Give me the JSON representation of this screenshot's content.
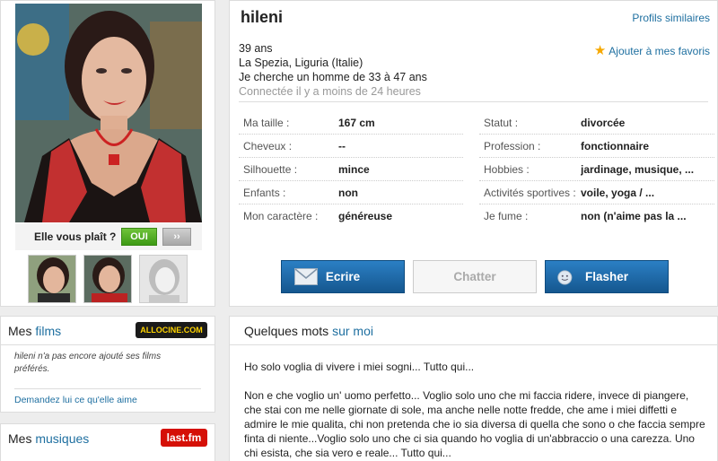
{
  "profile": {
    "username": "hileni",
    "similar_link": "Profils similaires",
    "favorite_label": "Ajouter à mes favoris",
    "age": "39 ans",
    "location": "La Spezia, Liguria (Italie)",
    "seeking": "Je cherche un homme de 33 à 47 ans",
    "last_online": "Connectée il y a moins de 24 heures"
  },
  "like_prompt": {
    "question": "Elle vous plaît ?",
    "yes_label": "OUI",
    "next_label": "››"
  },
  "attributes_left": [
    {
      "key": "Ma taille :",
      "value": "167 cm"
    },
    {
      "key": "Cheveux :",
      "value": "--"
    },
    {
      "key": "Silhouette :",
      "value": "mince"
    },
    {
      "key": "Enfants :",
      "value": "non"
    },
    {
      "key": "Mon caractère :",
      "value": "généreuse"
    }
  ],
  "attributes_right": [
    {
      "key": "Statut :",
      "value": "divorcée"
    },
    {
      "key": "Profession :",
      "value": "fonctionnaire"
    },
    {
      "key": "Hobbies :",
      "value": "jardinage, musique, ..."
    },
    {
      "key": "Activités sportives :",
      "value": "voile, yoga / ..."
    },
    {
      "key": "Je fume :",
      "value": "non (n'aime pas la ..."
    }
  ],
  "actions": {
    "write": "Ecrire",
    "chat": "Chatter",
    "flash": "Flasher"
  },
  "films": {
    "title_prefix": "Mes",
    "title_highlight": "films",
    "logo": "ALLOCINE.COM",
    "text": "hileni n'a pas encore ajouté ses films préférés.",
    "link": "Demandez lui ce qu'elle aime"
  },
  "music": {
    "title_prefix": "Mes",
    "title_highlight": "musiques",
    "logo": "last.fm"
  },
  "about": {
    "title_prefix": "Quelques mots",
    "title_highlight": "sur moi",
    "paragraphs": [
      "Ho solo voglia di vivere i miei sogni... Tutto qui...",
      "Non e che voglio un' uomo perfetto... Voglio solo uno che mi faccia ridere, invece di piangere, che stai con me nelle giornate di sole, ma anche nelle notte fredde, che ame i miei diffetti e admire le mie qualita, chi non pretenda che io sia diversa di quella che sono o che faccia sempre finta di niente...Voglio solo uno che ci sia quando ho voglia di un'abbraccio o una carezza. Uno chi esista, che sia vero e reale... Tutto qui..."
    ]
  },
  "colors": {
    "link": "#1e6fa0",
    "primary_button": "#1f6aa8",
    "yes_button": "#4fae22",
    "lastfm": "#d51007"
  }
}
